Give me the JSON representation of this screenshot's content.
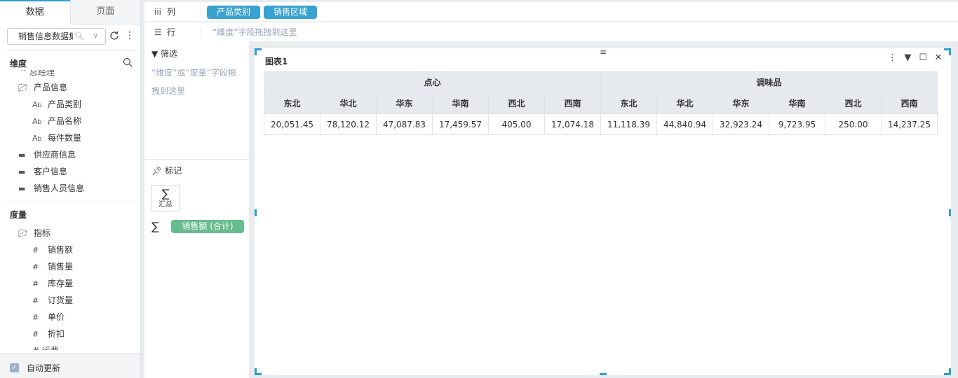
{
  "left_panel": {
    "tabs": [
      {
        "label": "数据",
        "active": true
      },
      {
        "label": "页面",
        "active": false
      }
    ],
    "dataset": {
      "value": "销售信息数据集",
      "search_icon": "search-icon",
      "chevron_icon": "chevron-down-icon"
    },
    "dimensions": {
      "title": "维度",
      "items": [
        {
          "label": "产品信息",
          "icon": "folder-open-icon"
        },
        {
          "label": "产品类别",
          "icon": "text-field-icon"
        },
        {
          "label": "产品名称",
          "icon": "text-field-icon"
        },
        {
          "label": "每件数量",
          "icon": "text-field-icon"
        },
        {
          "label": "供应商信息",
          "icon": "folder-icon"
        },
        {
          "label": "客户信息",
          "icon": "folder-icon"
        },
        {
          "label": "销售人员信息",
          "icon": "folder-icon"
        }
      ]
    },
    "measures": {
      "title": "度量",
      "items": [
        {
          "label": "指标",
          "icon": "folder-open-icon"
        },
        {
          "label": "销售额",
          "icon": "number-field-icon"
        },
        {
          "label": "销售量",
          "icon": "number-field-icon"
        },
        {
          "label": "库存量",
          "icon": "number-field-icon"
        },
        {
          "label": "订货量",
          "icon": "number-field-icon"
        },
        {
          "label": "单价",
          "icon": "number-field-icon"
        },
        {
          "label": "折扣",
          "icon": "number-field-icon"
        }
      ]
    },
    "auto_update": {
      "label": "自动更新",
      "checked": true
    }
  },
  "shelves": {
    "columns": {
      "label": "列",
      "pills": [
        "产品类别",
        "销售区域"
      ]
    },
    "rows": {
      "label": "行",
      "hint": "“维度”字段拖拽到这里"
    }
  },
  "mid_panel": {
    "filter": {
      "label": "筛选",
      "hint": "“维度”或“度量”字段拖拽到这里"
    },
    "marks": {
      "label": "标记",
      "sum_card": "汇总",
      "measure_pill": "销售额 (合计)"
    }
  },
  "chart": {
    "title": "图表1",
    "categories": [
      "点心",
      "调味品"
    ],
    "regions": [
      "东北",
      "华北",
      "华东",
      "华南",
      "西北",
      "西南"
    ],
    "rows": [
      [
        "20,051.45",
        "78,120.12",
        "47,087.83",
        "17,459.57",
        "405.00",
        "17,074.18",
        "11,118.39",
        "44,840.94",
        "32,923.24",
        "9,723.95",
        "250.00",
        "14,237.25"
      ]
    ]
  },
  "colors": {
    "accent": "#2d9fd3",
    "pill_blue": "#3aa2d0",
    "pill_green": "#67bb8d",
    "header_bg": "#e6e9ed"
  }
}
